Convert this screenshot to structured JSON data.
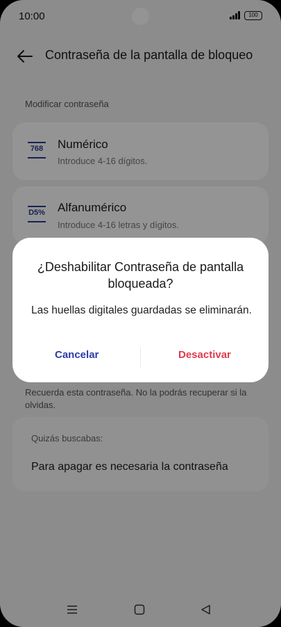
{
  "status_bar": {
    "time": "10:00",
    "battery": "100"
  },
  "header": {
    "title": "Contraseña de la pantalla de bloqueo",
    "back_icon": "arrow-left-icon"
  },
  "section": {
    "label": "Modificar contraseña"
  },
  "options": [
    {
      "icon_text": "768",
      "title": "Numérico",
      "subtitle": "Introduce 4-16 dígitos."
    },
    {
      "icon_text": "D5%",
      "title": "Alfanumérico",
      "subtitle": "Introduce 4-16 letras y dígitos."
    }
  ],
  "hint": "Recuerda esta contraseña. No la podrás recuperar si la olvidas.",
  "suggestion": {
    "label": "Quizás buscabas:",
    "link": "Para apagar es necesaria la contraseña"
  },
  "dialog": {
    "title": "¿Deshabilitar Contraseña de pantalla bloqueada?",
    "message": "Las huellas digitales guardadas se eliminarán.",
    "cancel_label": "Cancelar",
    "confirm_label": "Desactivar"
  },
  "colors": {
    "cancel": "#2b3ba8",
    "confirm": "#e03a4c",
    "icon": "#2b3a8f",
    "scrim": "rgba(0,0,0,0.42)"
  },
  "nav": {
    "icons": [
      "menu-icon",
      "home-icon",
      "back-triangle-icon"
    ]
  }
}
